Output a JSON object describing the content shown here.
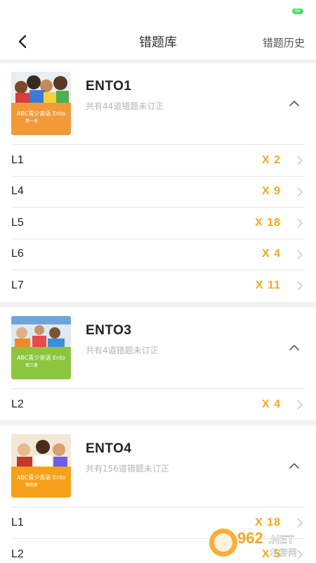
{
  "status": {
    "battery": "66"
  },
  "nav": {
    "title": "错题库",
    "history": "错题历史"
  },
  "books": [
    {
      "name": "ENTO1",
      "summary": "共有44道错题未订正",
      "cover_label": "ABC青少英语  Ento",
      "cover_volume": "第一册",
      "cover_color": "#f29a3a",
      "lessons": [
        {
          "name": "L1",
          "count": "X 2"
        },
        {
          "name": "L4",
          "count": "X 9"
        },
        {
          "name": "L5",
          "count": "X 18"
        },
        {
          "name": "L6",
          "count": "X 4"
        },
        {
          "name": "L7",
          "count": "X 11"
        }
      ]
    },
    {
      "name": "ENTO3",
      "summary": "共有4道错题未订正",
      "cover_label": "ABC青少英语  Ento",
      "cover_volume": "第三册",
      "cover_color": "#8cc63f",
      "lessons": [
        {
          "name": "L2",
          "count": "X 4"
        }
      ]
    },
    {
      "name": "ENTO4",
      "summary": "共有156道错题未订正",
      "cover_label": "ABC青少英语  Ento",
      "cover_volume": "第四册",
      "cover_color": "#f7a11a",
      "lessons": [
        {
          "name": "L1",
          "count": "X 18"
        },
        {
          "name": "L2",
          "count": "X 5"
        }
      ]
    }
  ],
  "watermark": {
    "logo": "962",
    "suffix": ".NET",
    "site": "乐游网"
  },
  "colors": {
    "accent": "#f2a81d",
    "title": "#222222",
    "muted": "#b5b5b5"
  }
}
